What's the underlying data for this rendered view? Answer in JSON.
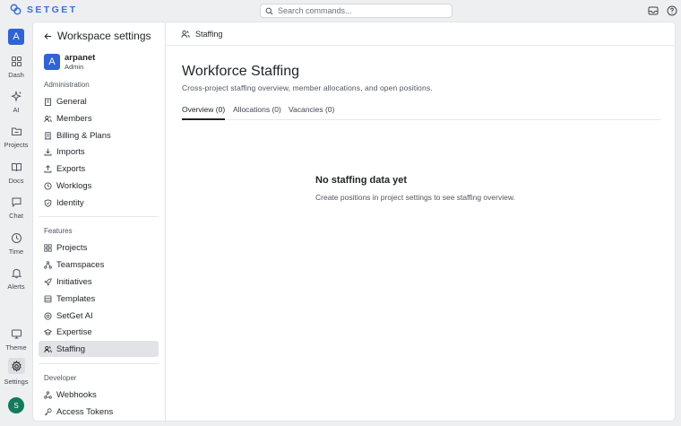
{
  "app": {
    "logo_text": "SETGET"
  },
  "search": {
    "placeholder": "Search commands..."
  },
  "rail": {
    "workspace_initial": "A",
    "items": [
      {
        "label": "Dash"
      },
      {
        "label": "AI"
      },
      {
        "label": "Projects"
      },
      {
        "label": "Docs"
      },
      {
        "label": "Chat"
      },
      {
        "label": "Time"
      },
      {
        "label": "Alerts"
      },
      {
        "label": "Theme"
      },
      {
        "label": "Settings"
      }
    ],
    "user_initial": "S"
  },
  "sidebar": {
    "title": "Workspace settings",
    "workspace": {
      "initial": "A",
      "name": "arpanet",
      "role": "Admin"
    },
    "administration": {
      "title": "Administration",
      "items": [
        {
          "label": "General"
        },
        {
          "label": "Members"
        },
        {
          "label": "Billing & Plans"
        },
        {
          "label": "Imports"
        },
        {
          "label": "Exports"
        },
        {
          "label": "Worklogs"
        },
        {
          "label": "Identity"
        }
      ]
    },
    "features": {
      "title": "Features",
      "items": [
        {
          "label": "Projects"
        },
        {
          "label": "Teamspaces"
        },
        {
          "label": "Initiatives"
        },
        {
          "label": "Templates"
        },
        {
          "label": "SetGet AI"
        },
        {
          "label": "Expertise"
        },
        {
          "label": "Staffing"
        }
      ]
    },
    "developer": {
      "title": "Developer",
      "items": [
        {
          "label": "Webhooks"
        },
        {
          "label": "Access Tokens"
        }
      ]
    }
  },
  "main": {
    "breadcrumb": "Staffing",
    "title": "Workforce Staffing",
    "subtitle": "Cross-project staffing overview, member allocations, and open positions.",
    "tabs": [
      {
        "label": "Overview (0)"
      },
      {
        "label": "Allocations (0)"
      },
      {
        "label": "Vacancies (0)"
      }
    ],
    "empty": {
      "title": "No staffing data yet",
      "subtitle": "Create positions in project settings to see staffing overview."
    }
  },
  "colors": {
    "accent": "#2f63d6",
    "user_avatar": "#137a5c",
    "logo": "#3b6fd9"
  }
}
